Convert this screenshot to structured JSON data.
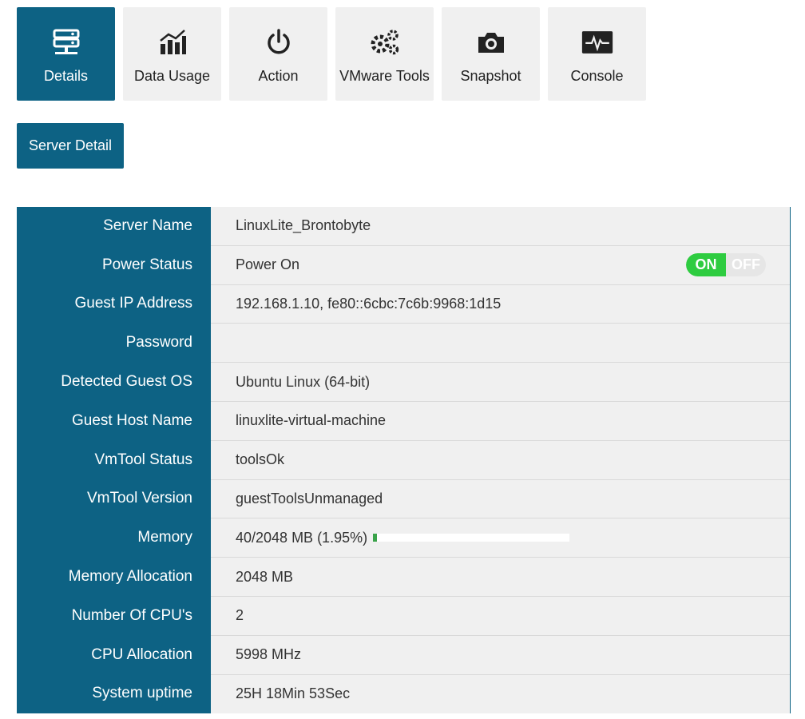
{
  "tabs": [
    {
      "label": "Details",
      "icon": "server-icon",
      "active": true
    },
    {
      "label": "Data Usage",
      "icon": "bar-chart-icon",
      "active": false
    },
    {
      "label": "Action",
      "icon": "power-icon",
      "active": false
    },
    {
      "label": "VMware Tools",
      "icon": "gears-icon",
      "active": false
    },
    {
      "label": "Snapshot",
      "icon": "camera-icon",
      "active": false
    },
    {
      "label": "Console",
      "icon": "console-icon",
      "active": false
    }
  ],
  "section_button": "Server Detail",
  "details": {
    "server_name": {
      "label": "Server Name",
      "value": "LinuxLite_Brontobyte"
    },
    "power_status": {
      "label": "Power Status",
      "value": "Power On",
      "toggle_on": "ON",
      "toggle_off": "OFF"
    },
    "guest_ip": {
      "label": "Guest IP Address",
      "value": "192.168.1.10, fe80::6cbc:7c6b:9968:1d15"
    },
    "password": {
      "label": "Password",
      "value": ""
    },
    "guest_os": {
      "label": "Detected Guest OS",
      "value": "Ubuntu Linux (64-bit)"
    },
    "host_name": {
      "label": "Guest Host Name",
      "value": "linuxlite-virtual-machine"
    },
    "vmtool_status": {
      "label": "VmTool Status",
      "value": "toolsOk"
    },
    "vmtool_version": {
      "label": "VmTool Version",
      "value": "guestToolsUnmanaged"
    },
    "memory": {
      "label": "Memory",
      "value": "40/2048 MB (1.95%)",
      "usage_fraction": 0.0195
    },
    "memory_allocation": {
      "label": "Memory Allocation",
      "value": "2048 MB"
    },
    "cpu_count": {
      "label": "Number Of CPU's",
      "value": "2"
    },
    "cpu_allocation": {
      "label": "CPU Allocation",
      "value": "5998 MHz"
    },
    "uptime": {
      "label": "System uptime",
      "value": "25H 18Min 53Sec"
    }
  },
  "colors": {
    "primary": "#0d6284",
    "on": "#2ecc40",
    "memory_fill": "#3aa34a"
  }
}
